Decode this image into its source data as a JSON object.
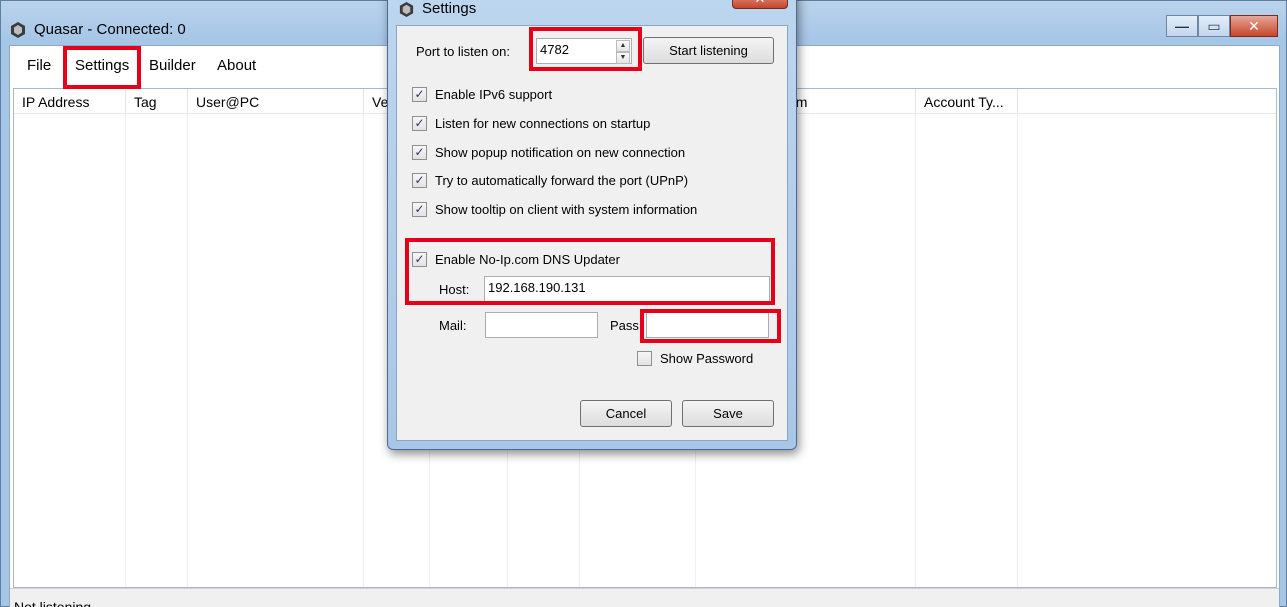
{
  "main_window": {
    "title": "Quasar - Connected: 0",
    "controls": {
      "minimize": "—",
      "maximize": "▭",
      "close": "✕"
    }
  },
  "menu": {
    "items": [
      "File",
      "Settings",
      "Builder",
      "About"
    ]
  },
  "grid": {
    "columns": [
      "IP Address",
      "Tag",
      "User@PC",
      "Ver",
      "",
      "",
      "",
      "em",
      "Account Ty..."
    ]
  },
  "status": {
    "text": "Not listening"
  },
  "dialog": {
    "title": "Settings",
    "close": "✕",
    "port_label": "Port to listen on:",
    "port_value": "4782",
    "start_button": "Start listening",
    "options": [
      {
        "label": "Enable IPv6 support",
        "checked": true
      },
      {
        "label": "Listen for new connections on startup",
        "checked": true
      },
      {
        "label": "Show popup notification on new connection",
        "checked": true
      },
      {
        "label": "Try to automatically forward the port (UPnP)",
        "checked": true
      },
      {
        "label": "Show tooltip on client with system information",
        "checked": true
      }
    ],
    "noip": {
      "label": "Enable No-Ip.com DNS Updater",
      "checked": true
    },
    "host_label": "Host:",
    "host_value": "192.168.190.131",
    "mail_label": "Mail:",
    "mail_value": "",
    "pass_label": "Pass:",
    "pass_value": "",
    "show_password": {
      "label": "Show Password",
      "checked": false
    },
    "cancel_button": "Cancel",
    "save_button": "Save"
  },
  "colors": {
    "highlight": "#e6001a",
    "title_bar": "#a6c6e6"
  },
  "check_glyph": "✓"
}
